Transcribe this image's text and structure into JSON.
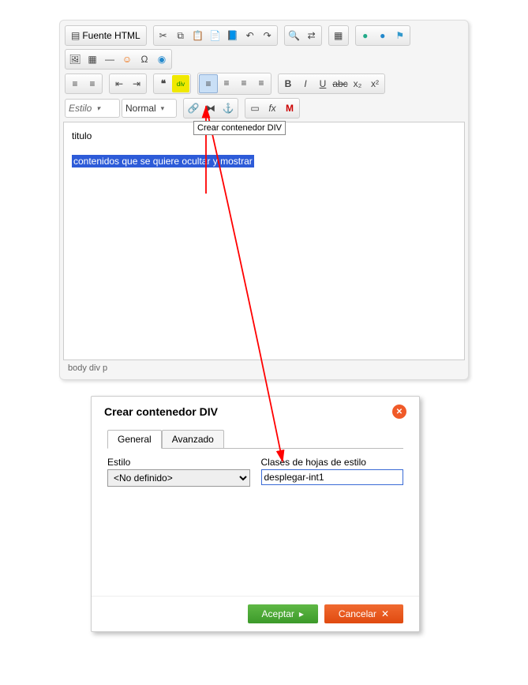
{
  "toolbar": {
    "source_label": "Fuente HTML",
    "style_label": "Estilo",
    "format_label": "Normal"
  },
  "tooltip": "Crear contenedor DIV",
  "content": {
    "title": "titulo",
    "selected": "contenidos que se quiere ocultar y mostrar"
  },
  "status": "body  div  p",
  "dialog": {
    "title": "Crear contenedor DIV",
    "tabs": {
      "general": "General",
      "advanced": "Avanzado"
    },
    "style_label": "Estilo",
    "style_value": "<No definido>",
    "classes_label": "Clases de hojas de estilo",
    "classes_value": "desplegar-int1",
    "accept": "Aceptar",
    "cancel": "Cancelar"
  }
}
